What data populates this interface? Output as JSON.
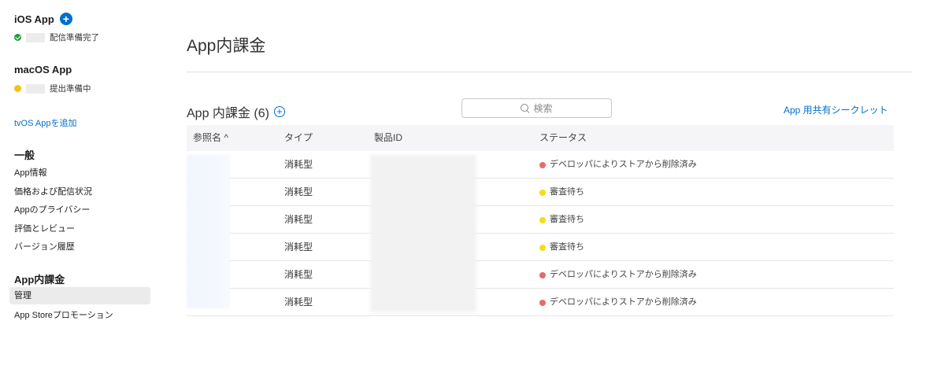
{
  "sidebar": {
    "ios": {
      "title": "iOS App",
      "status": "配信準備完了"
    },
    "macos": {
      "title": "macOS App",
      "status": "提出準備中"
    },
    "add_tvos": "tvOS Appを追加",
    "general": {
      "heading": "一般",
      "items": [
        "App情報",
        "価格および配信状況",
        "Appのプライバシー",
        "評価とレビュー",
        "バージョン履歴"
      ]
    },
    "iap": {
      "heading": "App内課金",
      "items": [
        "管理",
        "App Storeプロモーション"
      ]
    }
  },
  "main": {
    "title": "App内課金",
    "section_title": "App 内課金 (6)",
    "search_placeholder": "検索",
    "shared_secret_link": "App 用共有シークレット",
    "columns": [
      "参照名 ^",
      "タイプ",
      "製品ID",
      "ステータス"
    ],
    "rows": [
      {
        "type": "消耗型",
        "status": "デベロッパによりストアから削除済み",
        "status_color": "#e46b6b"
      },
      {
        "type": "消耗型",
        "status": "審査待ち",
        "status_color": "#f4dc18"
      },
      {
        "type": "消耗型",
        "status": "審査待ち",
        "status_color": "#f4dc18"
      },
      {
        "type": "消耗型",
        "status": "審査待ち",
        "status_color": "#f4dc18"
      },
      {
        "type": "消耗型",
        "status": "デベロッパによりストアから削除済み",
        "status_color": "#e46b6b"
      },
      {
        "type": "消耗型",
        "status": "デベロッパによりストアから削除済み",
        "status_color": "#e46b6b"
      }
    ]
  },
  "colors": {
    "accent": "#0070c9",
    "status_ready": "#1f9d3a",
    "status_pending": "#f5c211"
  }
}
